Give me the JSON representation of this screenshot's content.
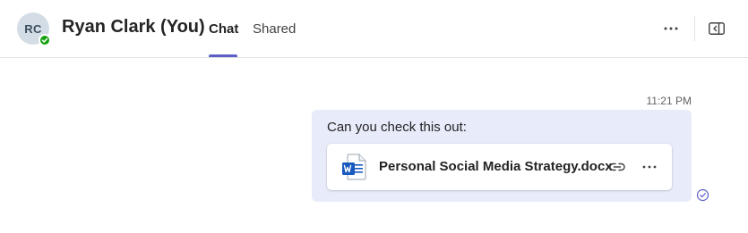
{
  "header": {
    "avatar_initials": "RC",
    "presence_status": "available",
    "title": "Ryan Clark (You)",
    "tabs": [
      {
        "label": "Chat",
        "active": true
      },
      {
        "label": "Shared",
        "active": false
      }
    ],
    "icons": {
      "more": "more-horizontal-icon",
      "panel": "side-panel-icon"
    }
  },
  "message": {
    "timestamp": "11:21 PM",
    "text": "Can you check this out:",
    "attachment": {
      "file_name": "Personal Social Media Strategy.docx",
      "file_type_icon": "word-document-icon"
    },
    "read_receipt_icon": "check-circle-icon"
  },
  "colors": {
    "accent": "#5b5fc7",
    "bubble_background": "#e8ebfa",
    "presence_available": "#13a10e",
    "word_blue": "#185abd"
  }
}
